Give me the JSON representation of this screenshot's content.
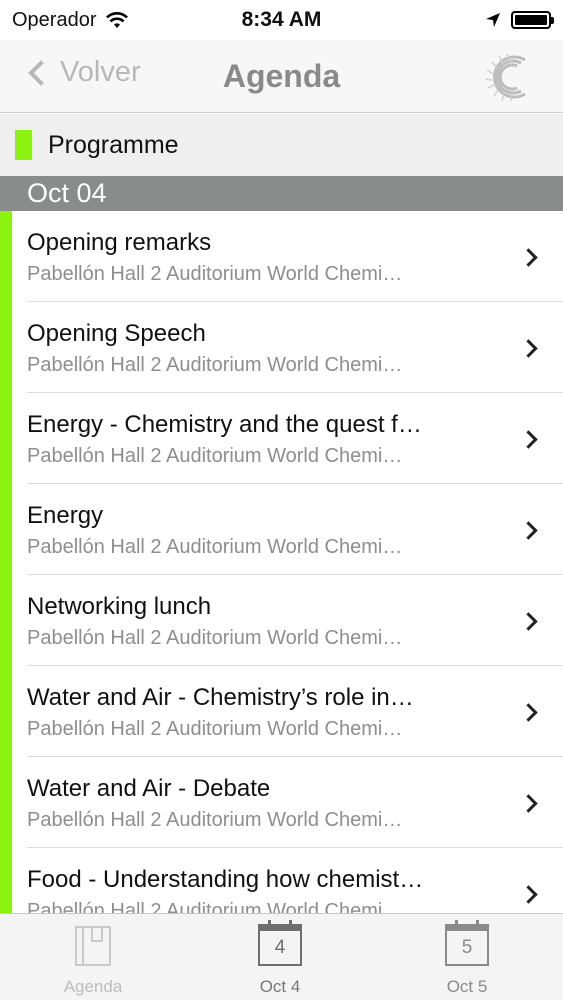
{
  "status_bar": {
    "carrier": "Operador",
    "time": "8:34 AM"
  },
  "nav": {
    "back_label": "Volver",
    "title": "Agenda"
  },
  "section": {
    "title": "Programme",
    "accent_color": "#8cf210"
  },
  "date_header": "Oct 04",
  "items": [
    {
      "title": "Opening remarks",
      "subtitle": "Pabellón Hall 2 Auditorium World Chemi…"
    },
    {
      "title": "Opening Speech",
      "subtitle": "Pabellón Hall 2 Auditorium World Chemi…"
    },
    {
      "title": "Energy - Chemistry and the quest f…",
      "subtitle": "Pabellón Hall 2 Auditorium World Chemi…"
    },
    {
      "title": "Energy",
      "subtitle": "Pabellón Hall 2 Auditorium World Chemi…"
    },
    {
      "title": "Networking lunch",
      "subtitle": "Pabellón Hall 2 Auditorium World Chemi…"
    },
    {
      "title": "Water and Air - Chemistry’s role in…",
      "subtitle": "Pabellón Hall 2 Auditorium World Chemi…"
    },
    {
      "title": "Water and Air - Debate",
      "subtitle": "Pabellón Hall 2 Auditorium World Chemi…"
    },
    {
      "title": "Food - Understanding how chemist…",
      "subtitle": "Pabellón Hall 2 Auditorium World Chemi…"
    }
  ],
  "tabs": [
    {
      "label": "Agenda",
      "icon": "book-icon"
    },
    {
      "label": "Oct 4",
      "icon": "calendar-icon",
      "day": "4"
    },
    {
      "label": "Oct 5",
      "icon": "calendar-icon",
      "day": "5"
    }
  ]
}
